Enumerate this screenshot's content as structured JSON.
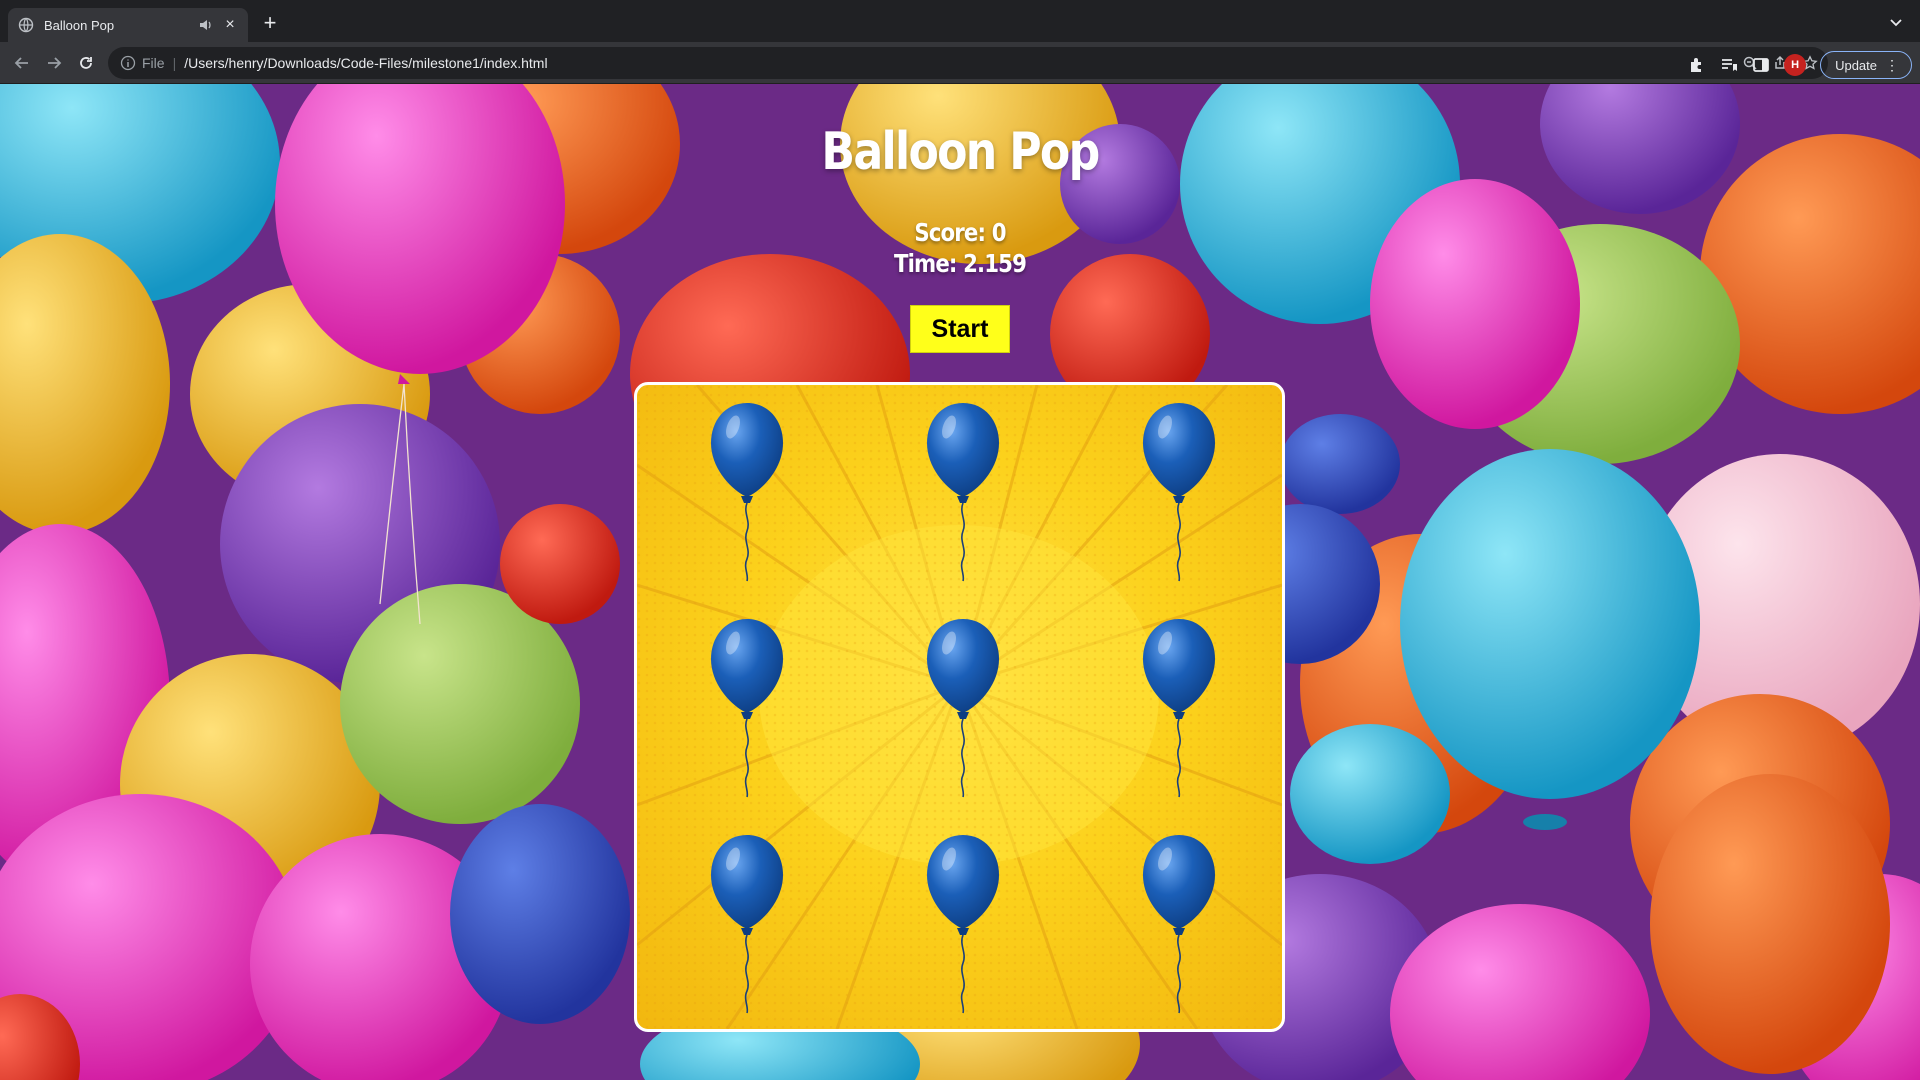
{
  "browser": {
    "tab_title": "Balloon Pop",
    "url_scheme": "File",
    "url": "/Users/henry/Downloads/Code-Files/milestone1/index.html",
    "profile_initial": "H",
    "update_label": "Update"
  },
  "game": {
    "title": "Balloon Pop",
    "score_text": "Score: 0",
    "time_text": "Time: 2.159",
    "start_label": "Start",
    "balloon_color": "#1b5fb8",
    "board_color": "#fcd21c",
    "balloons": [
      {
        "id": "balloon-1"
      },
      {
        "id": "balloon-2"
      },
      {
        "id": "balloon-3"
      },
      {
        "id": "balloon-4"
      },
      {
        "id": "balloon-5"
      },
      {
        "id": "balloon-6"
      },
      {
        "id": "balloon-7"
      },
      {
        "id": "balloon-8"
      },
      {
        "id": "balloon-9"
      }
    ]
  },
  "icons": [
    "globe-icon",
    "audio-icon",
    "close-icon",
    "plus-icon",
    "back-icon",
    "forward-icon",
    "reload-icon",
    "info-icon",
    "zoom-icon",
    "share-icon",
    "star-icon",
    "extensions-icon",
    "reading-list-icon",
    "side-panel-icon",
    "tab-search-icon"
  ]
}
